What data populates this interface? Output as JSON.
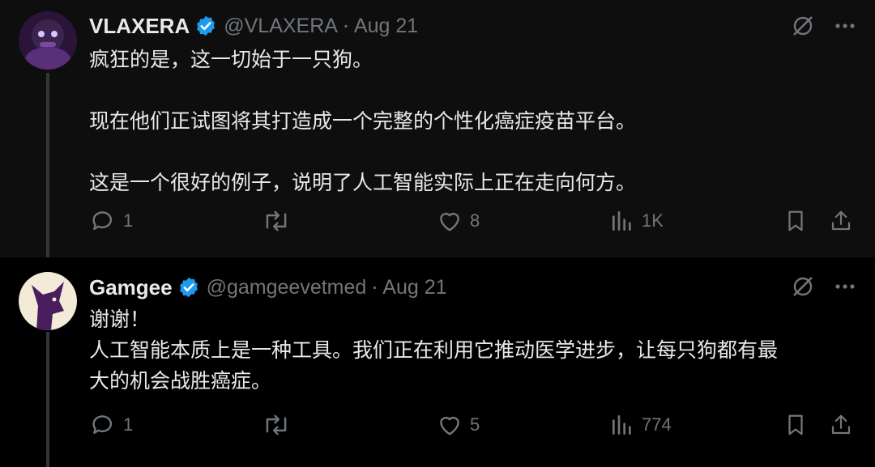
{
  "tweets": [
    {
      "name": "VLAXERA",
      "handle": "@VLAXERA",
      "separator": "·",
      "date": "Aug 21",
      "text": "疯狂的是，这一切始于一只狗。\n\n现在他们正试图将其打造成一个完整的个性化癌症疫苗平台。\n\n这是一个很好的例子，说明了人工智能实际上正在走向何方。",
      "replies": "1",
      "retweets": "",
      "likes": "8",
      "views": "1K",
      "verified_color": "#1d9bf0"
    },
    {
      "name": "Gamgee",
      "handle": "@gamgeevetmed",
      "separator": "·",
      "date": "Aug 21",
      "text": "谢谢！\n人工智能本质上是一种工具。我们正在利用它推动医学进步，让每只狗都有最\n大的机会战胜癌症。",
      "replies": "1",
      "retweets": "",
      "likes": "5",
      "views": "774",
      "verified_color": "#1d9bf0"
    }
  ],
  "colors": {
    "muted": "#71767b",
    "text": "#e7e9ea",
    "accent": "#1d9bf0",
    "avatar2_bg": "#4a1d5e"
  },
  "icons": [
    "verified-badge-icon",
    "grok-icon",
    "more-icon",
    "reply-icon",
    "retweet-icon",
    "like-icon",
    "views-icon",
    "bookmark-icon",
    "share-icon"
  ]
}
